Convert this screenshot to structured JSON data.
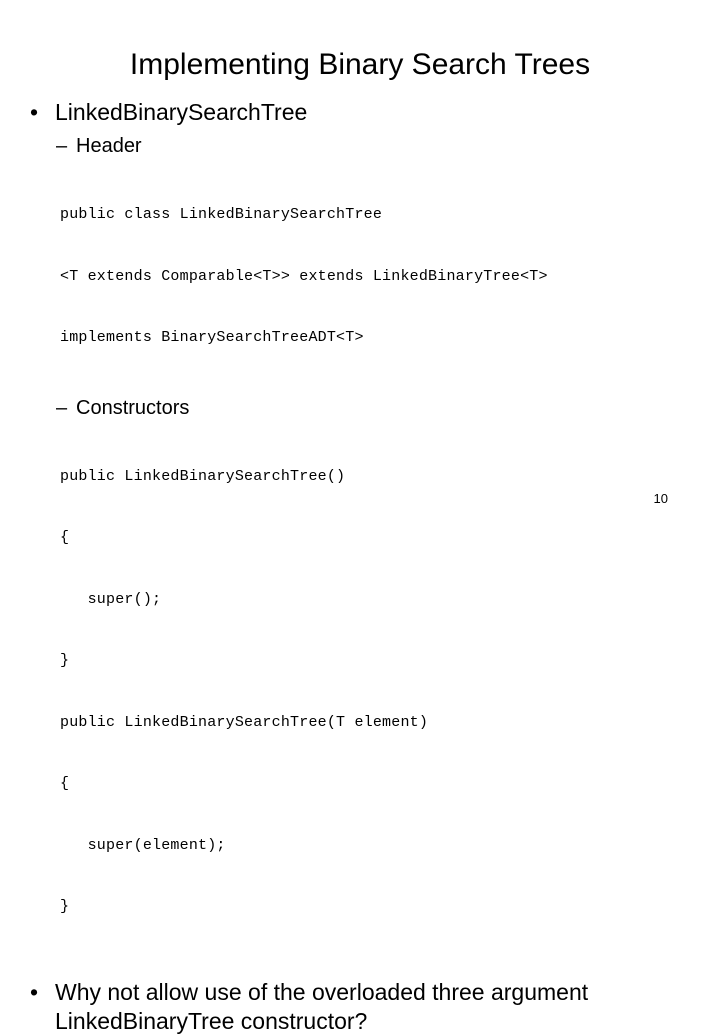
{
  "slide": {
    "title": "Implementing Binary Search Trees",
    "page_number": "10",
    "bullet_marker": "•",
    "dash_marker": "–",
    "topic": "LinkedBinarySearchTree",
    "sections": [
      {
        "heading": "Header",
        "code": [
          "public class LinkedBinarySearchTree",
          "<T extends Comparable<T>> extends LinkedBinaryTree<T>",
          "implements BinarySearchTreeADT<T>"
        ]
      },
      {
        "heading": "Constructors",
        "code": [
          "public LinkedBinarySearchTree()",
          "{",
          "   super();",
          "}",
          "public LinkedBinarySearchTree(T element)",
          "{",
          "   super(element);",
          "}"
        ]
      }
    ],
    "question": "Why not allow use of the overloaded three argument LinkedBinaryTree constructor?"
  }
}
